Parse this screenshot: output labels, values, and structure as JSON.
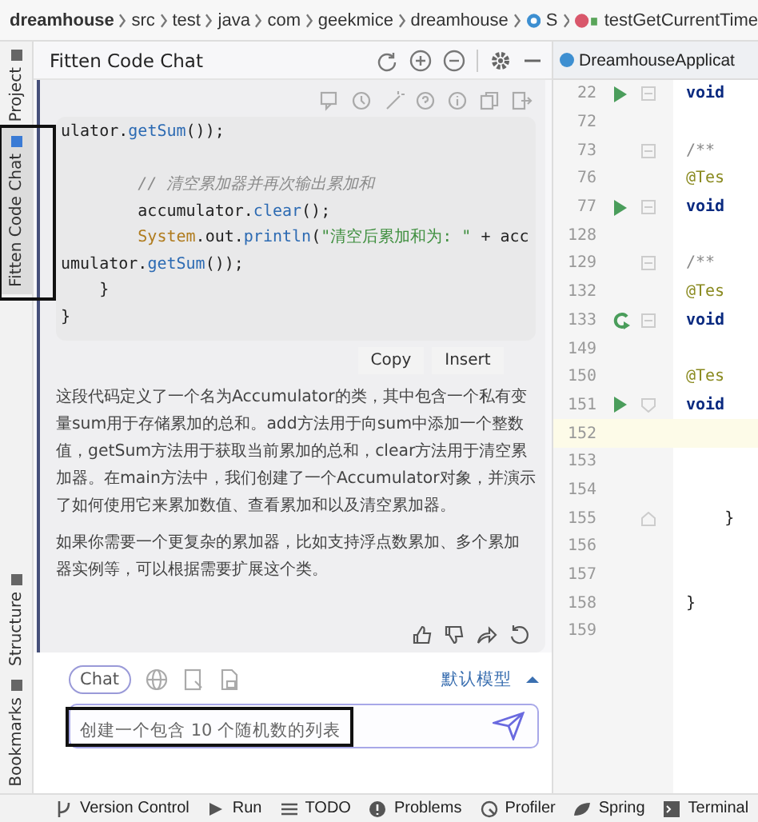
{
  "breadcrumb": [
    {
      "label": "dreamhouse",
      "kind": "root"
    },
    {
      "label": "src",
      "kind": "folder"
    },
    {
      "label": "test",
      "kind": "folder"
    },
    {
      "label": "java",
      "kind": "folder"
    },
    {
      "label": "com",
      "kind": "folder"
    },
    {
      "label": "geekmice",
      "kind": "folder"
    },
    {
      "label": "dreamhouse",
      "kind": "folder"
    },
    {
      "label": "S",
      "kind": "class"
    },
    {
      "label": "testGetCurrentTime",
      "kind": "method"
    }
  ],
  "side_tabs_top": [
    {
      "label": "Project",
      "selected": false,
      "highlighted": false
    },
    {
      "label": "Fitten Code Chat",
      "selected": true,
      "highlighted": true
    }
  ],
  "side_tabs_bottom": [
    {
      "label": "Structure",
      "selected": false,
      "highlighted": false
    },
    {
      "label": "Bookmarks",
      "selected": false,
      "highlighted": false
    }
  ],
  "chat": {
    "title": "Fitten Code Chat",
    "code_lines": [
      {
        "kind": "code",
        "tokens": [
          {
            "text": "ulator.",
            "kind": "plain"
          },
          {
            "text": "getSum",
            "kind": "method"
          },
          {
            "text": "());",
            "kind": "plain"
          }
        ]
      },
      {
        "kind": "blank"
      },
      {
        "kind": "code",
        "tokens": [
          {
            "text": "        // 清空累加器并再次输出累加和",
            "kind": "comment"
          }
        ]
      },
      {
        "kind": "code",
        "tokens": [
          {
            "text": "        accumulator.",
            "kind": "plain"
          },
          {
            "text": "clear",
            "kind": "method"
          },
          {
            "text": "();",
            "kind": "plain"
          }
        ]
      },
      {
        "kind": "code",
        "tokens": [
          {
            "text": "        System",
            "kind": "class"
          },
          {
            "text": ".out.",
            "kind": "plain"
          },
          {
            "text": "println",
            "kind": "method"
          },
          {
            "text": "(",
            "kind": "plain"
          },
          {
            "text": "\"清空后累加和为: \"",
            "kind": "string"
          },
          {
            "text": " + acc",
            "kind": "plain"
          }
        ]
      },
      {
        "kind": "code",
        "tokens": [
          {
            "text": "umulator.",
            "kind": "plain"
          },
          {
            "text": "getSum",
            "kind": "method"
          },
          {
            "text": "());",
            "kind": "plain"
          }
        ]
      },
      {
        "kind": "code",
        "tokens": [
          {
            "text": "    }",
            "kind": "plain"
          }
        ]
      },
      {
        "kind": "code",
        "tokens": [
          {
            "text": "}",
            "kind": "plain"
          }
        ]
      }
    ],
    "code_buttons": [
      "Copy",
      "Insert"
    ],
    "paragraphs": [
      "这段代码定义了一个名为Accumulator的类，其中包含一个私有变量sum用于存储累加的总和。add方法用于向sum中添加一个整数值，getSum方法用于获取当前累加的总和，clear方法用于清空累加器。在main方法中，我们创建了一个Accumulator对象，并演示了如何使用它来累加数值、查看累加和以及清空累加器。",
      "如果你需要一个更复杂的累加器，比如支持浮点数累加、多个累加器实例等，可以根据需要扩展这个类。"
    ],
    "mode": {
      "label": "Chat",
      "selected": true
    },
    "model": "默认模型",
    "input": {
      "value": "创建一个包含 10 个随机数的列表",
      "highlighted": true
    }
  },
  "editor": {
    "tab": "DreamhouseApplicat",
    "lines": [
      {
        "number": "22",
        "code": "void",
        "kind": "keyword",
        "current": false
      },
      {
        "number": "72",
        "kind": "blank",
        "current": false
      },
      {
        "number": "73",
        "code": "/**",
        "kind": "comment",
        "current": false
      },
      {
        "number": "76",
        "code": "@Tes",
        "kind": "annotation",
        "current": false
      },
      {
        "number": "77",
        "code": "void",
        "kind": "keyword",
        "current": false
      },
      {
        "number": "128",
        "kind": "blank",
        "current": false
      },
      {
        "number": "129",
        "code": "/**",
        "kind": "comment",
        "current": false
      },
      {
        "number": "132",
        "code": "@Tes",
        "kind": "annotation",
        "current": false
      },
      {
        "number": "133",
        "code": "void",
        "kind": "keyword",
        "current": false
      },
      {
        "number": "149",
        "kind": "blank",
        "current": false
      },
      {
        "number": "150",
        "code": "@Tes",
        "kind": "annotation",
        "current": false
      },
      {
        "number": "151",
        "code": "void",
        "kind": "keyword",
        "current": false
      },
      {
        "number": "152",
        "kind": "blank",
        "current": true
      },
      {
        "number": "153",
        "kind": "blank",
        "current": false
      },
      {
        "number": "154",
        "kind": "blank",
        "current": false
      },
      {
        "number": "155",
        "code": "    }",
        "kind": "plain",
        "current": false
      },
      {
        "number": "156",
        "kind": "blank",
        "current": false
      },
      {
        "number": "157",
        "kind": "blank",
        "current": false
      },
      {
        "number": "158",
        "code": "}",
        "kind": "plain",
        "current": false
      },
      {
        "number": "159",
        "kind": "blank",
        "current": false
      }
    ]
  },
  "status_bar": [
    {
      "label": "Version Control"
    },
    {
      "label": "Run"
    },
    {
      "label": "TODO"
    },
    {
      "label": "Problems"
    },
    {
      "label": "Profiler"
    },
    {
      "label": "Spring"
    },
    {
      "label": "Terminal"
    }
  ]
}
